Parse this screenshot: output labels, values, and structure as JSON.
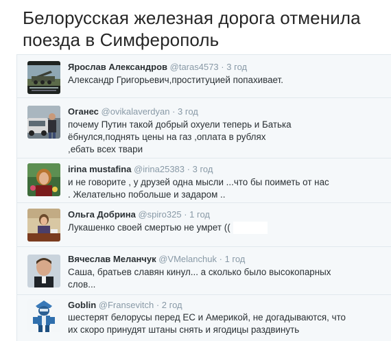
{
  "headline": "Белорусская железная дорога отменила поезда в Симферополь",
  "tweets": [
    {
      "name": "Ярослав Александров",
      "handle": "@taras4573",
      "dot": "·",
      "time": "3 год",
      "text": "Александр Григорьевич,проституцией попахивает."
    },
    {
      "name": "Оганес",
      "handle": "@ovikalaverdyan",
      "dot": "·",
      "time": "3 год",
      "text": "почему Путин такой добрый охуели теперь и Батька\nёбнулся,поднять цены на газ ,оплата в рублях\n,ебать всех твари"
    },
    {
      "name": "irina mustafina",
      "handle": "@irina25383",
      "dot": "·",
      "time": "3 год",
      "text": "и не говорите , у друзей одна мысли ...что бы поиметь от нас\n. Желательно побольше и задаром .."
    },
    {
      "name": "Ольга Добрина",
      "handle": "@spiro325",
      "dot": "·",
      "time": "1 год",
      "text": "Лукашенко своей смертью не умрет (("
    },
    {
      "name": "Вячеслав Меланчук",
      "handle": "@VMelanchuk",
      "dot": "·",
      "time": "1 год",
      "text": "Саша, братьев славян кинул... а сколько было высокопарных\nслов..."
    },
    {
      "name": "Goblin",
      "handle": "@Fransevitch",
      "dot": "·",
      "time": "2 год",
      "text": "шестерят белорусы перед ЕС и Америкой, не догадываются, что\nих скоро принудят штаны снять и ягодицы раздвинуть"
    }
  ]
}
